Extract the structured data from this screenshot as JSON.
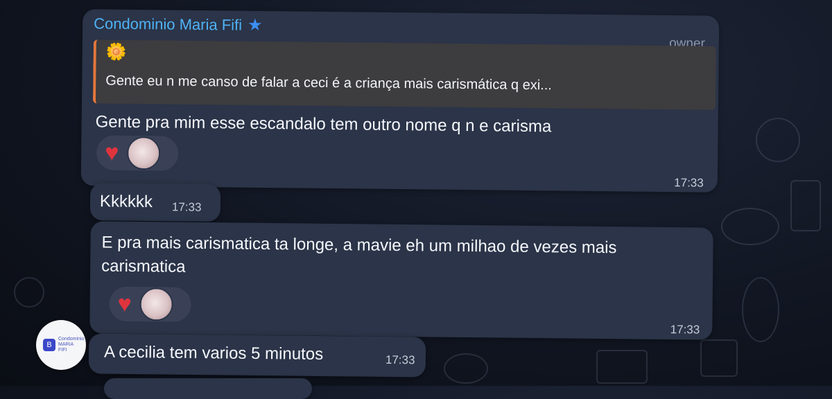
{
  "messages": [
    {
      "sender": "Condominio Maria Fifi",
      "role": "owner",
      "reply_to": {
        "emoji": "🌼",
        "text": "Gente eu n me canso de falar a ceci é a criança mais carismática q exi..."
      },
      "text": "Gente pra mim esse escandalo tem outro nome q n e carisma",
      "time": "17:33",
      "reaction": "heart"
    },
    {
      "text": "Kkkkkk",
      "time": "17:33"
    },
    {
      "text": "E pra mais carismatica ta longe, a mavie eh um milhao de vezes mais carismatica",
      "time": "17:33",
      "reaction": "heart"
    },
    {
      "text": "A cecilia tem varios 5 minutos",
      "time": "17:33"
    }
  ],
  "avatar": {
    "icon_letter": "B",
    "caption": "Condominio MARIA FIFI"
  },
  "colors": {
    "bubble": "#2b3448",
    "sender_name": "#4fb2f4",
    "reply_bar": "#e4773c",
    "heart": "#e0343d"
  }
}
